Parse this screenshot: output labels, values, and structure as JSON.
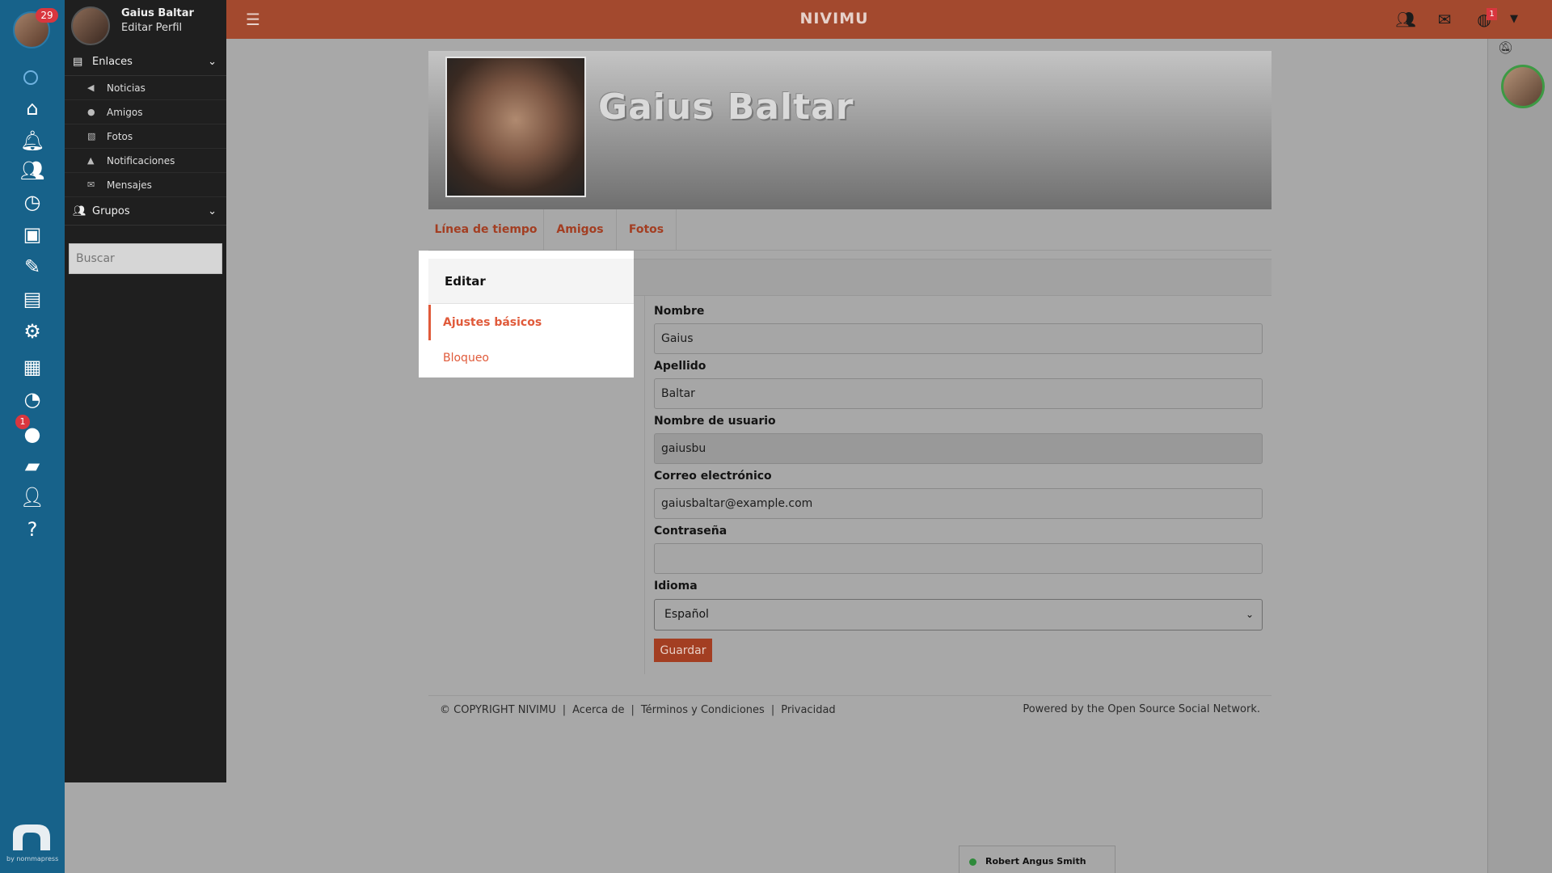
{
  "app": {
    "brand": "NIVIMU"
  },
  "rail": {
    "notification_count": "29",
    "chat_badge": "1",
    "footer_by": "by nommapress",
    "icons": [
      "circle-icon",
      "home-icon",
      "bell-icon",
      "users-icon",
      "clock-icon",
      "briefcase-icon",
      "broom-icon",
      "id-card-icon",
      "gear-icon",
      "clipboard-icon",
      "pie-chart-icon",
      "chat-icon",
      "folder-icon",
      "user-money-icon",
      "question-icon"
    ]
  },
  "sidebar": {
    "user_name": "Gaius Baltar",
    "edit_profile": "Editar Perfil",
    "sections": [
      {
        "label": "Enlaces",
        "icon": "newspaper-icon"
      },
      {
        "label": "Grupos",
        "icon": "users-icon"
      }
    ],
    "links": [
      {
        "label": "Noticias",
        "icon": "bullhorn-icon"
      },
      {
        "label": "Amigos",
        "icon": "users-icon"
      },
      {
        "label": "Fotos",
        "icon": "image-icon"
      },
      {
        "label": "Notificaciones",
        "icon": "bell-icon"
      },
      {
        "label": "Mensajes",
        "icon": "envelope-icon"
      }
    ],
    "search_placeholder": "Buscar"
  },
  "topbar": {
    "notifications_badge": "1",
    "icons": [
      "friends-icon",
      "envelope-icon",
      "globe-icon",
      "caret-down-icon"
    ]
  },
  "profile": {
    "name": "Gaius Baltar"
  },
  "tabs": [
    "Línea de tiempo",
    "Amigos",
    "Fotos"
  ],
  "edit_menu": {
    "title": "Editar",
    "items": [
      "Ajustes básicos",
      "Bloqueo"
    ]
  },
  "form": {
    "first_name_label": "Nombre",
    "first_name_value": "Gaius",
    "last_name_label": "Apellido",
    "last_name_value": "Baltar",
    "username_label": "Nombre de usuario",
    "username_value": "gaiusbu",
    "email_label": "Correo electrónico",
    "email_value": "gaiusbaltar@example.com",
    "password_label": "Contraseña",
    "password_value": "",
    "language_label": "Idioma",
    "language_value": "Español",
    "save_label": "Guardar"
  },
  "footer": {
    "copyright": "© COPYRIGHT NIVIMU",
    "about": "Acerca de",
    "terms": "Términos y Condiciones",
    "privacy": "Privacidad",
    "powered": "Powered by the Open Source Social Network."
  },
  "chat": {
    "contact_name": "Robert Angus Smith"
  },
  "colors": {
    "rail": "#17628a",
    "topbar": "#a3492e",
    "accent": "#e05a3a",
    "sidebar": "#1f1f1f",
    "online": "#2e8a3a"
  }
}
